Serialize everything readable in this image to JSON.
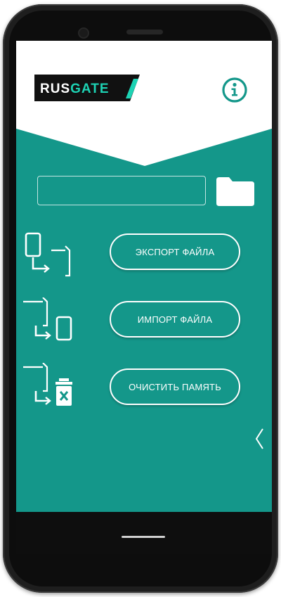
{
  "app": {
    "logo_text_left": "RUS",
    "logo_text_right": "GATE"
  },
  "file": {
    "value": "",
    "placeholder": ""
  },
  "actions": {
    "export_label": "ЭКСПОРТ ФАЙЛА",
    "import_label": "ИМПОРТ ФАЙЛА",
    "clear_label": "ОЧИСТИТЬ ПАМЯТЬ"
  },
  "icons": {
    "info": "info-circle-icon",
    "folder": "folder-icon",
    "export": "export-phone-icon",
    "import": "import-phone-icon",
    "clear": "clear-memory-trash-icon",
    "drawer": "chevron-left-icon"
  },
  "colors": {
    "primary": "#14978a",
    "logo_bg": "#111111",
    "logo_accent": "#1dd3b4",
    "white": "#ffffff",
    "navbar": "#0e0e0e"
  }
}
